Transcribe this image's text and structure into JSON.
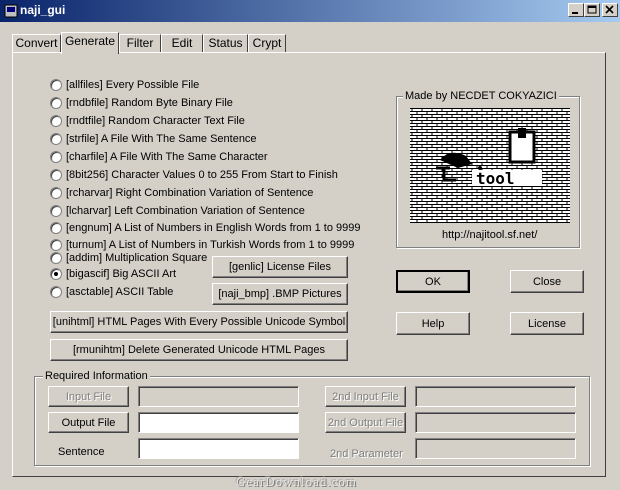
{
  "window": {
    "title": "naji_gui"
  },
  "tabs": [
    "Convert",
    "Generate",
    "Filter",
    "Edit",
    "Status",
    "Crypt"
  ],
  "active_tab": "Generate",
  "options": [
    {
      "label": "[allfiles]  Every Possible File",
      "checked": false
    },
    {
      "label": "[rndbfile]  Random Byte Binary File",
      "checked": false
    },
    {
      "label": "[rndtfile]  Random Character Text File",
      "checked": false
    },
    {
      "label": "[strfile]  A File With The Same Sentence",
      "checked": false
    },
    {
      "label": "[charfile]  A File With The Same Character",
      "checked": false
    },
    {
      "label": "[8bit256]  Character Values 0 to 255 From Start to Finish",
      "checked": false
    },
    {
      "label": "[rcharvar]  Right Combination Variation of Sentence",
      "checked": false
    },
    {
      "label": "[lcharvar]  Left Combination Variation of Sentence",
      "checked": false
    },
    {
      "label": "[engnum]  A List of Numbers in English Words from 1 to 9999",
      "checked": false
    },
    {
      "label": "[turnum]  A List of Numbers in Turkish Words from 1 to 9999",
      "checked": false
    },
    {
      "label": "[addim]  Multiplication Square",
      "checked": false
    },
    {
      "label": "[bigascif]  Big ASCII Art",
      "checked": true
    },
    {
      "label": "[asctable]  ASCII Table",
      "checked": false
    }
  ],
  "buttons": {
    "genlic": "[genlic]  License Files",
    "naji_bmp": "[naji_bmp]  .BMP Pictures",
    "unihtml": "[unihtml]  HTML Pages With Every Possible Unicode Symbol",
    "rmunihtm": "[rmunihtm]  Delete Generated Unicode HTML Pages",
    "ok": "OK",
    "close": "Close",
    "help": "Help",
    "license": "License"
  },
  "logo_box": {
    "caption": "Made by NECDET COKYAZICI",
    "logo_text": "tool",
    "url": "http://najitool.sf.net/"
  },
  "required_info": {
    "title": "Required Information",
    "input_file_button": "Input File",
    "output_file_button": "Output File",
    "sentence_label": "Sentence",
    "second_input_button": "2nd Input File",
    "second_output_button": "2nd Output File",
    "second_param_label": "2nd Parameter",
    "input_file_value": "",
    "output_file_value": "",
    "sentence_value": "",
    "second_input_value": "",
    "second_output_value": "",
    "second_param_value": ""
  },
  "watermark": "GearDownload.com",
  "colors": {
    "titlebar_start": "#0a246a",
    "titlebar_end": "#a6caf0",
    "face": "#d4d0c8"
  }
}
